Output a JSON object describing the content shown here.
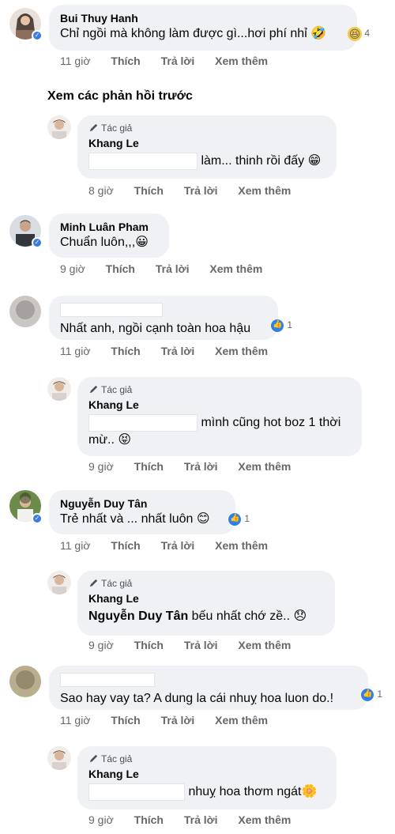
{
  "see_previous_label": "Xem các phản hồi trước",
  "actions": {
    "like": "Thích",
    "reply": "Trả lời",
    "more": "Xem thêm"
  },
  "comments": [
    {
      "author": "Bui Thuy Hanh",
      "text": "Chỉ ngồi mà không làm được gì...hơi phí nhỉ",
      "emoji": "🤣",
      "reaction_count": "4",
      "time": "11 giờ"
    },
    {
      "tag": "Tác giả",
      "author": "Khang Le",
      "text": "làm... thinh rồi đấy",
      "emoji": "😁",
      "time": "8 giờ"
    },
    {
      "author": "Minh Luân Pham",
      "text": "Chuẩn luôn,,,",
      "emoji": "😀",
      "time": "9 giờ"
    },
    {
      "author": "",
      "text": "Nhất anh, ngồi cạnh toàn hoa hậu",
      "reaction_count": "1",
      "time": "11 giờ"
    },
    {
      "tag": "Tác giả",
      "author": "Khang Le",
      "text_line1": "mình cũng hot boz 1 thời",
      "text_line2": "mừ..",
      "emoji": "😝",
      "time": "9 giờ"
    },
    {
      "author": "Nguyễn Duy Tân",
      "text": "Trẻ nhất và ... nhất luôn",
      "emoji": "😊",
      "reaction_count": "1",
      "time": "11 giờ"
    },
    {
      "tag": "Tác giả",
      "author": "Khang Le",
      "mention": "Nguyễn Duy Tân",
      "text": " bếu nhất chớ zề..",
      "emoji": "😞",
      "time": "9 giờ"
    },
    {
      "author": "",
      "text": "Sao hay vay ta? A dung la cái nhuỵ hoa luon do.!",
      "reaction_count": "1",
      "time": "11 giờ"
    },
    {
      "tag": "Tác giả",
      "author": "Khang Le",
      "text": "nhuỵ hoa thơm ngát",
      "emoji": "🌼",
      "time": "9 giờ"
    }
  ]
}
